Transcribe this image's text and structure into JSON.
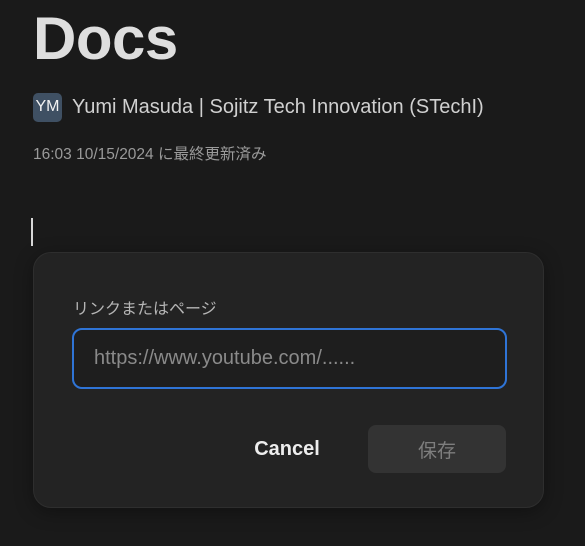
{
  "page": {
    "title": "Docs",
    "author": {
      "initials": "YM",
      "name": "Yumi Masuda | Sojitz Tech Innovation (STechI)"
    },
    "last_updated": "16:03 10/15/2024 に最終更新済み"
  },
  "link_dialog": {
    "label": "リンクまたはページ",
    "input_value": "",
    "input_placeholder": "https://www.youtube.com/......",
    "cancel_label": "Cancel",
    "save_label": "保存"
  },
  "colors": {
    "background": "#1a1a1a",
    "dialog_background": "#232323",
    "input_focus_border": "#2f74d6",
    "avatar_background": "#3f5063",
    "save_button_disabled": "#333333"
  }
}
